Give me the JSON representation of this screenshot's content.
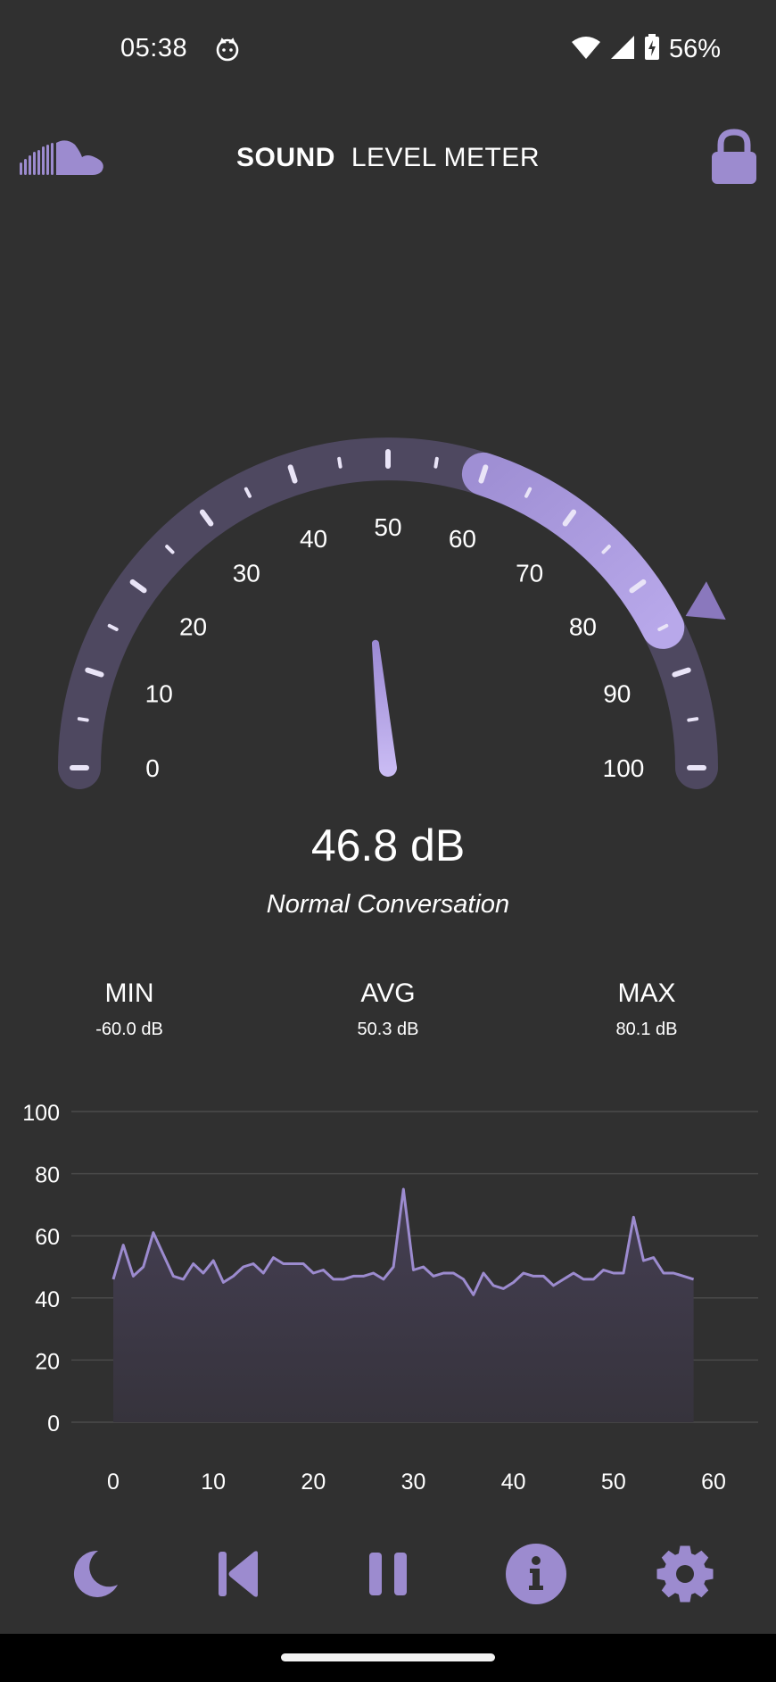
{
  "status_bar": {
    "time": "05:38",
    "battery": "56%",
    "icons": [
      "cat-notification-icon",
      "wifi-icon",
      "signal-icon",
      "battery-charging-icon"
    ]
  },
  "header": {
    "title_bold": "SOUND",
    "title_rest": "LEVEL METER",
    "left_icon": "soundcloud-logo",
    "right_icon": "lock-icon"
  },
  "gauge": {
    "min": 0,
    "max": 100,
    "tick_labels": [
      "0",
      "10",
      "20",
      "30",
      "40",
      "50",
      "60",
      "70",
      "80",
      "90",
      "100"
    ],
    "needle_value": 46.8,
    "highlight_range": [
      60,
      85
    ],
    "max_marker_value": 85
  },
  "reading": {
    "value": "46.8 dB",
    "description": "Normal Conversation"
  },
  "stats": {
    "min_label": "MIN",
    "min_value": "-60.0 dB",
    "avg_label": "AVG",
    "avg_value": "50.3 dB",
    "max_label": "MAX",
    "max_value": "80.1 dB"
  },
  "chart_data": {
    "type": "area",
    "x_ticks": [
      "0",
      "10",
      "20",
      "30",
      "40",
      "50",
      "60"
    ],
    "y_ticks": [
      "0",
      "20",
      "40",
      "60",
      "80",
      "100"
    ],
    "xlim": [
      0,
      60
    ],
    "ylim": [
      0,
      100
    ],
    "grid": true,
    "series": [
      {
        "values": [
          46,
          57,
          47,
          50,
          61,
          54,
          47,
          46,
          51,
          48,
          52,
          45,
          47,
          50,
          51,
          48,
          53,
          51,
          51,
          51,
          48,
          49,
          46,
          46,
          47,
          47,
          48,
          46,
          50,
          75,
          49,
          50,
          47,
          48,
          48,
          46,
          41,
          48,
          44,
          43,
          45,
          48,
          47,
          47,
          44,
          46,
          48,
          46,
          46,
          49,
          48,
          48,
          66,
          52,
          53,
          48,
          48,
          47,
          46
        ]
      }
    ]
  },
  "bottom_bar": {
    "buttons": [
      "moon-icon",
      "skip-back-icon",
      "pause-icon",
      "info-icon",
      "settings-icon"
    ]
  },
  "colors": {
    "background": "#303030",
    "accent": "#9c8bcf",
    "accent_light": "#c3b5ef",
    "gauge_track": "#4e4860",
    "grid": "#4a4a4a"
  }
}
